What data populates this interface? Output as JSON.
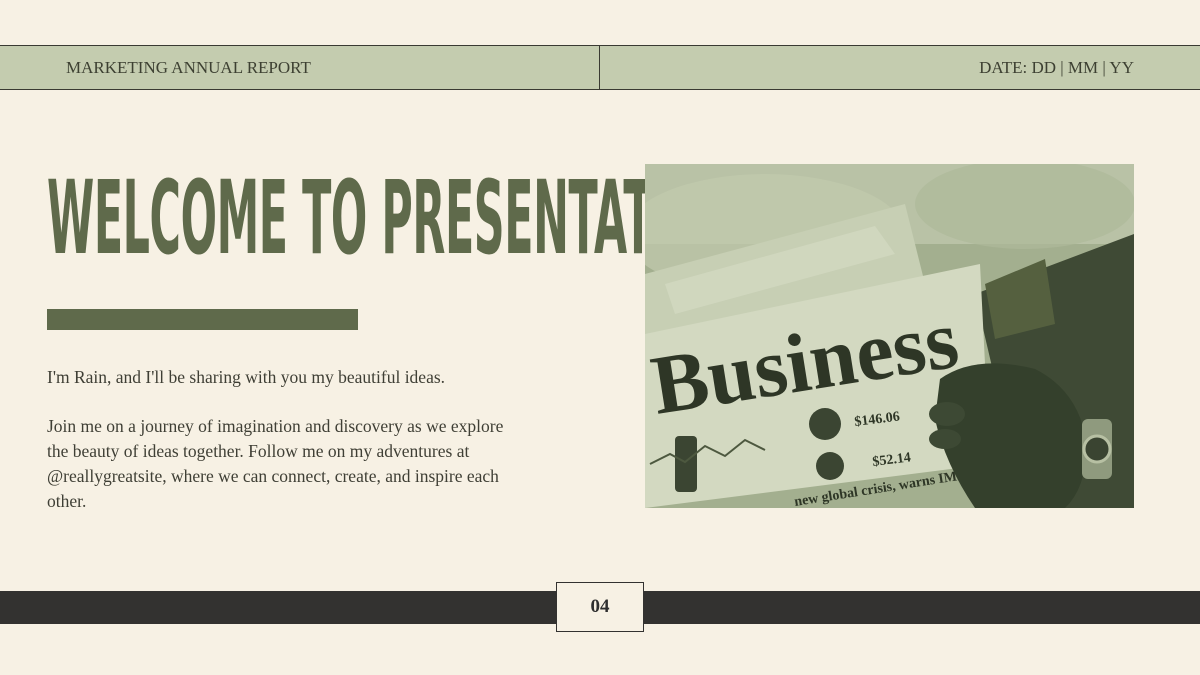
{
  "header": {
    "left": "MARKETING ANNUAL REPORT",
    "right": "DATE: DD | MM | YY"
  },
  "main": {
    "title": "WELCOME TO PRESENTATION",
    "paragraph1": "I'm Rain, and I'll be sharing with you my beautiful ideas.",
    "paragraph2": "Join me on a journey of imagination and discovery as we explore the beauty of ideas together. Follow me on my adventures at @reallygreatsite, where we can connect, create, and inspire each other."
  },
  "photo": {
    "headline": "Business",
    "price1": "$146.06",
    "price2": "$52.14",
    "subhead": "new global crisis, warns IMF"
  },
  "footer": {
    "page_number": "04"
  },
  "colors": {
    "background": "#f7f1e4",
    "header": "#c4ccaf",
    "accent": "#5f6a4b",
    "footer": "#333230"
  }
}
